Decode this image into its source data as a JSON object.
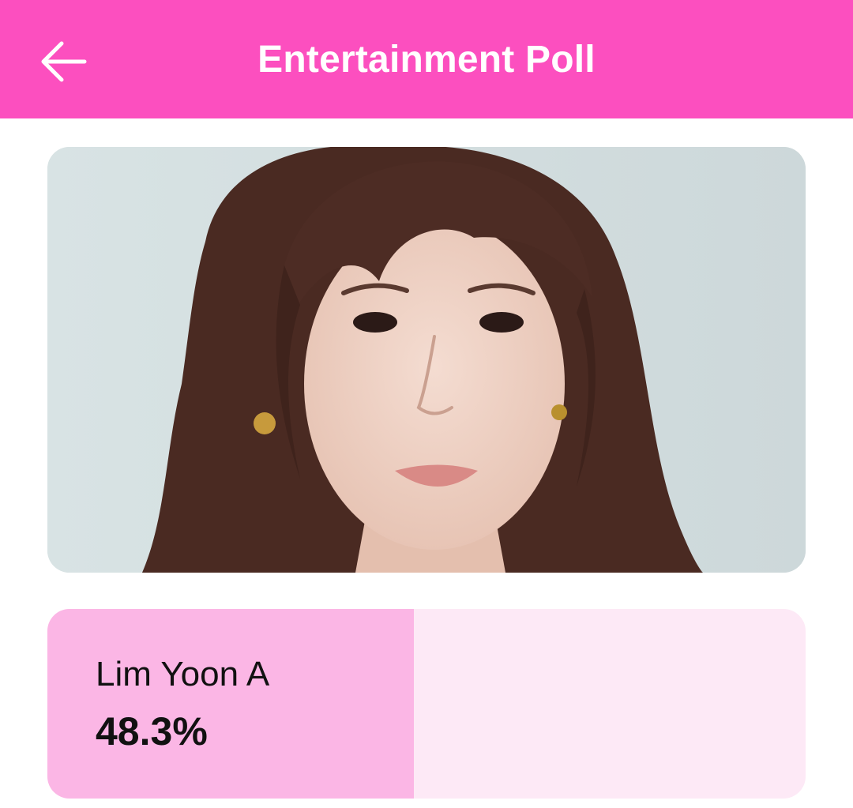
{
  "header": {
    "title": "Entertainment Poll",
    "back_icon": "arrow-left-icon",
    "background_color": "#fc4fbf"
  },
  "photo": {
    "subject": "portrait-photo"
  },
  "poll": {
    "option": {
      "name": "Lim Yoon A",
      "percent_label": "48.3%",
      "percent_value": 48.3
    },
    "fill_color": "#fbb6e5",
    "track_color": "#fde9f6"
  }
}
